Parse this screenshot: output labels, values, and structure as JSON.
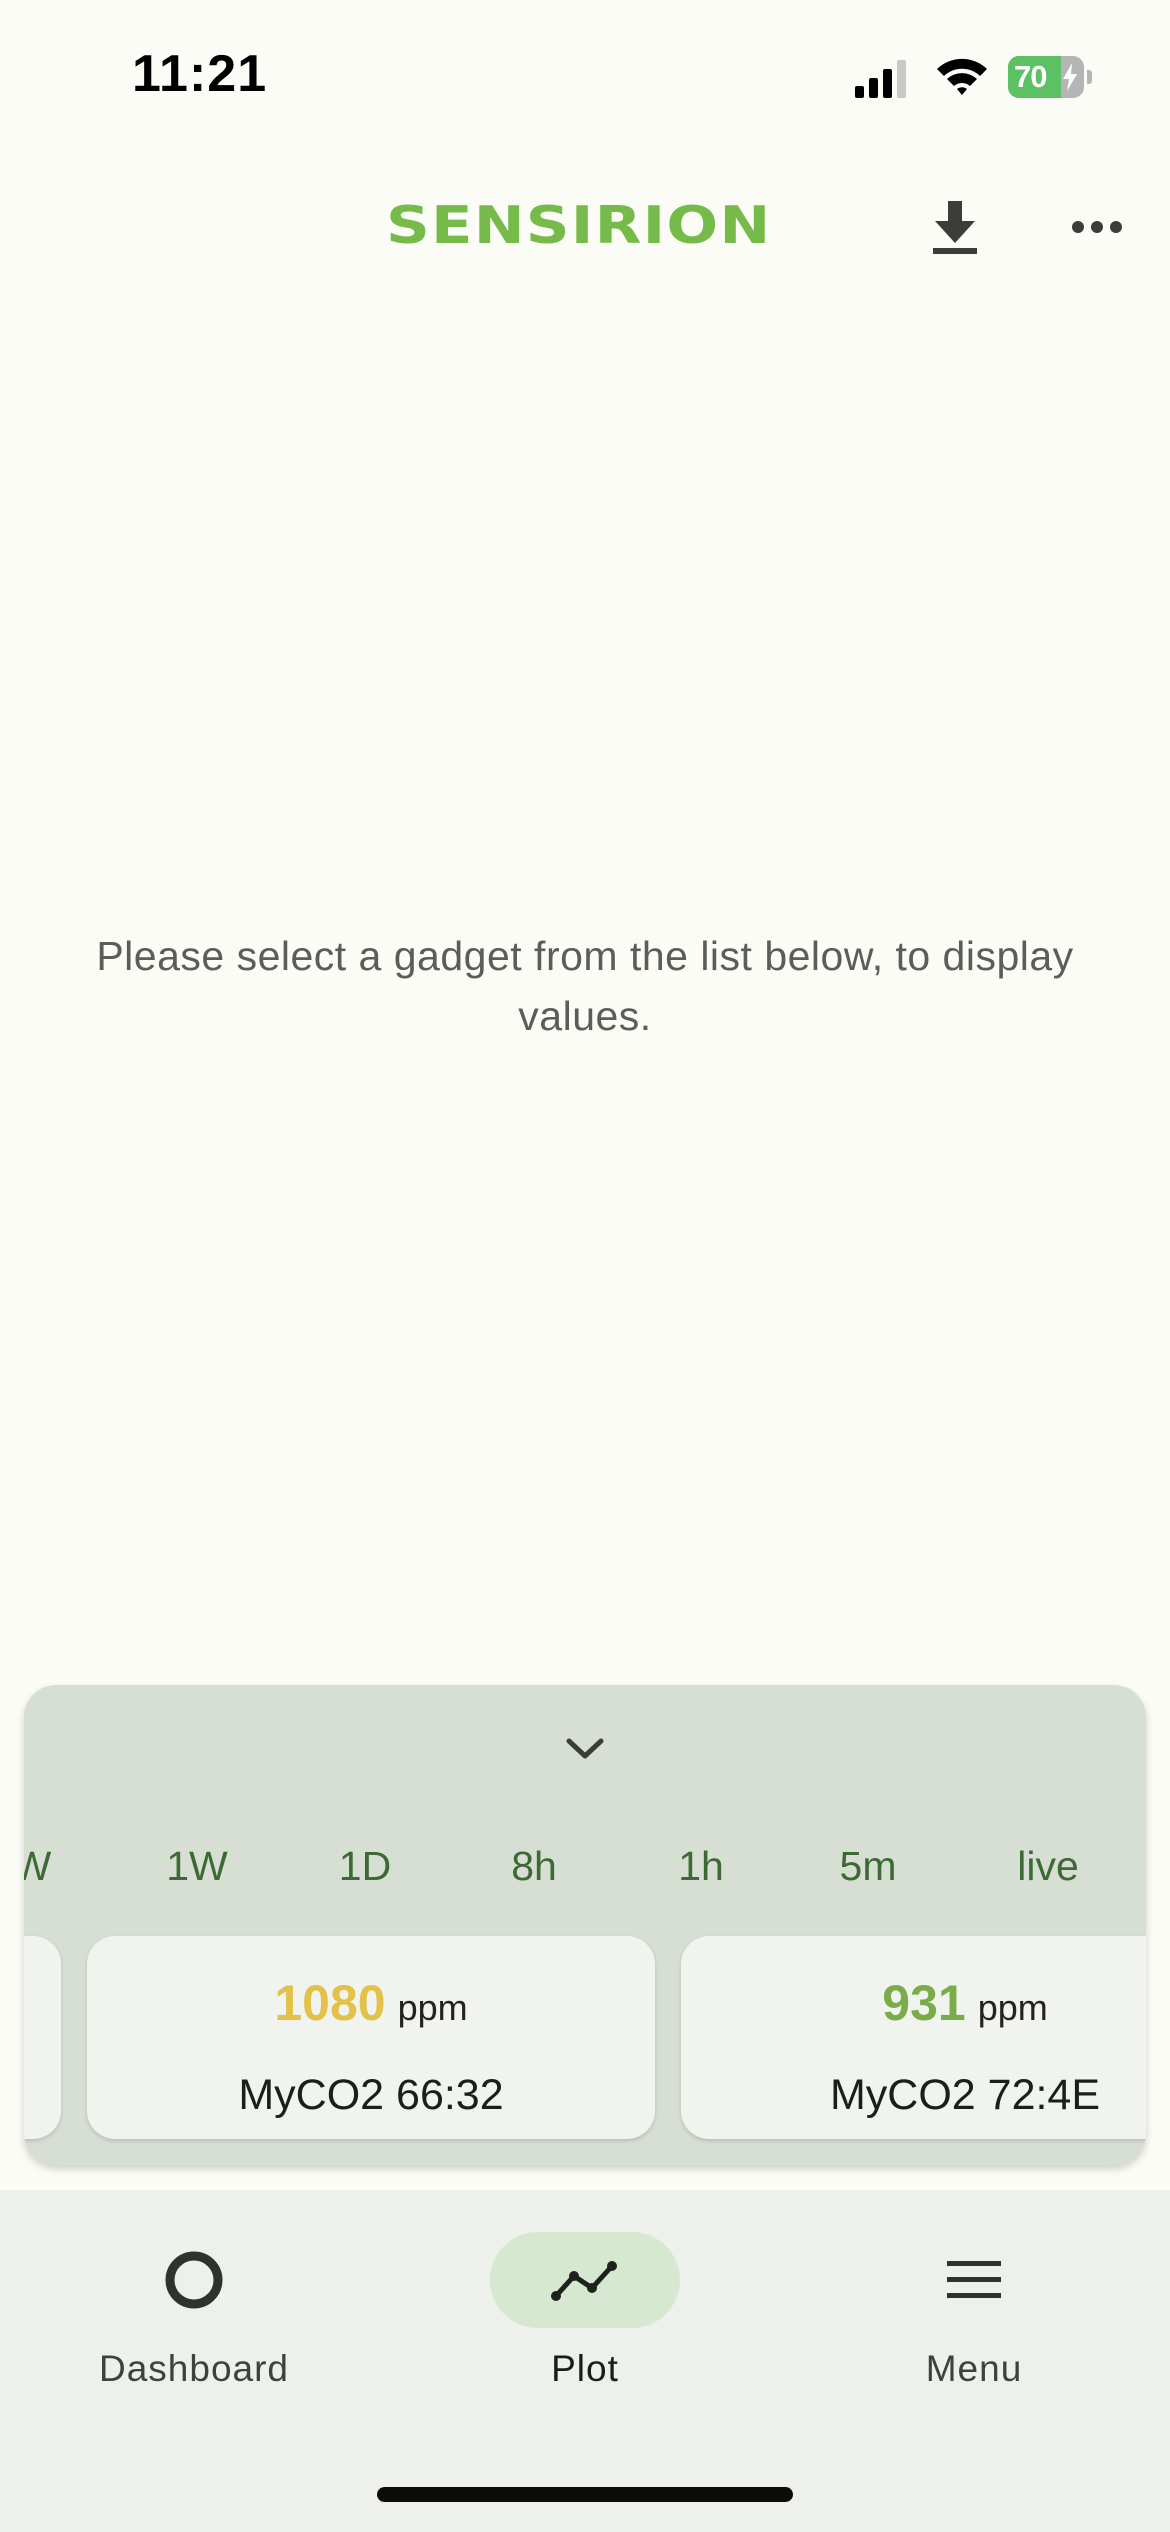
{
  "status_bar": {
    "time": "11:21",
    "battery_level": "70",
    "battery_fraction": 0.7,
    "battery_color": "#5cc162"
  },
  "app_bar": {
    "logo_text": "SENSIRION",
    "logo_color": "#76bb4a",
    "download_icon": "download-icon",
    "more_icon": "more-horizontal-icon"
  },
  "main": {
    "empty_message": "Please select a gadget from the list below, to display values."
  },
  "sheet": {
    "collapse_icon": "chevron-down-icon",
    "time_ranges": [
      {
        "label": "W"
      },
      {
        "label": "1W"
      },
      {
        "label": "1D"
      },
      {
        "label": "8h"
      },
      {
        "label": "1h"
      },
      {
        "label": "5m"
      },
      {
        "label": "live"
      }
    ],
    "gadgets": [
      {
        "value": "1080",
        "unit": "ppm",
        "name": "MyCO2 66:32",
        "value_color": "#e2c24a"
      },
      {
        "value": "931",
        "unit": "ppm",
        "name": "MyCO2 72:4E",
        "value_color": "#7aac4a"
      }
    ]
  },
  "bottom_nav": {
    "items": [
      {
        "label": "Dashboard",
        "icon": "circle-icon",
        "active": false
      },
      {
        "label": "Plot",
        "icon": "plot-line-icon",
        "active": true
      },
      {
        "label": "Menu",
        "icon": "hamburger-menu-icon",
        "active": false
      }
    ],
    "active_color": "#d6e8cf"
  }
}
